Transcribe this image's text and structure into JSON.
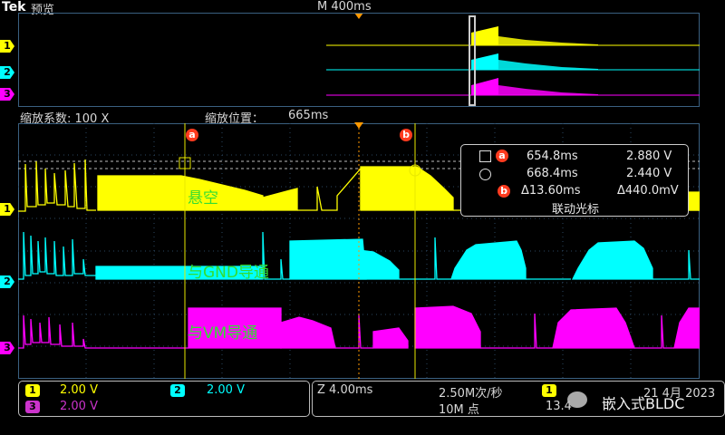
{
  "header": {
    "brand": "Tek",
    "mode": "预览",
    "timebase": "M 400ms"
  },
  "zoom": {
    "factor_label": "缩放系数: 100 X",
    "position_label": "缩放位置：",
    "position_value": "665ms"
  },
  "cursors": {
    "a_label": "a",
    "b_label": "b",
    "readout": {
      "a_time": "654.8ms",
      "a_volt": "2.880 V",
      "b_time": "668.4ms",
      "b_volt": "2.440 V",
      "delta_time": "Δ13.60ms",
      "delta_volt": "Δ440.0mV",
      "link_label": "联动光标"
    }
  },
  "annotations": {
    "ch1": "悬空",
    "ch2": "与GND导通",
    "ch3": "与VM导通"
  },
  "channels": [
    {
      "num": "1",
      "scale": "2.00 V",
      "color": "#ffff00"
    },
    {
      "num": "2",
      "scale": "2.00 V",
      "color": "#00ffff"
    },
    {
      "num": "3",
      "scale": "2.00 V",
      "color": "#ff00ff"
    }
  ],
  "status": {
    "zoom_time": "Z 4.00ms",
    "sample_rate": "2.50M次/秒",
    "record_length": "10M 点",
    "trigger_ch": "1",
    "trigger_partial": "13.4",
    "date": "21 4月 2023",
    "watermark": "嵌入式BLDC"
  }
}
